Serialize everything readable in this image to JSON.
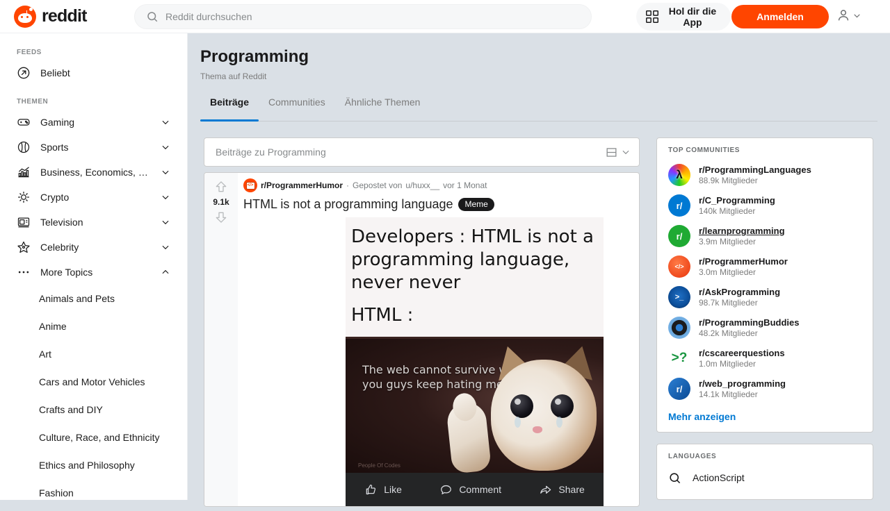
{
  "header": {
    "brand": "reddit",
    "logo_icon": "reddit-logo-icon",
    "search_placeholder": "Reddit durchsuchen",
    "search_icon": "search-icon",
    "get_app_label": "Hol dir die App",
    "qr_icon": "qr-code-icon",
    "login_label": "Anmelden",
    "user_icon": "user-avatar-icon",
    "user_chevron_icon": "chevron-down-icon"
  },
  "sidebar": {
    "feeds_header": "FEEDS",
    "feeds": [
      {
        "label": "Beliebt",
        "icon": "popular-arrow-icon"
      }
    ],
    "topics_header": "THEMEN",
    "topics": [
      {
        "label": "Gaming",
        "icon": "gamepad-icon",
        "chevron": "chevron-down-icon"
      },
      {
        "label": "Sports",
        "icon": "baseball-icon",
        "chevron": "chevron-down-icon"
      },
      {
        "label": "Business, Economics, a...",
        "icon": "bar-chart-icon",
        "chevron": "chevron-down-icon"
      },
      {
        "label": "Crypto",
        "icon": "crypto-icon",
        "chevron": "chevron-down-icon"
      },
      {
        "label": "Television",
        "icon": "television-icon",
        "chevron": "chevron-down-icon"
      },
      {
        "label": "Celebrity",
        "icon": "star-icon",
        "chevron": "chevron-down-icon"
      },
      {
        "label": "More Topics",
        "icon": "ellipsis-icon",
        "chevron": "chevron-up-icon"
      }
    ],
    "more_topics": [
      "Animals and Pets",
      "Anime",
      "Art",
      "Cars and Motor Vehicles",
      "Crafts and DIY",
      "Culture, Race, and Ethnicity",
      "Ethics and Philosophy",
      "Fashion"
    ]
  },
  "main": {
    "title": "Programming",
    "subtitle": "Thema auf Reddit",
    "tabs": [
      {
        "label": "Beiträge",
        "active": true
      },
      {
        "label": "Communities",
        "active": false
      },
      {
        "label": "Ähnliche Themen",
        "active": false
      }
    ],
    "sort": {
      "label": "Beiträge zu Programming",
      "view_icon": "card-view-icon",
      "chevron_icon": "chevron-down-icon"
    },
    "post": {
      "upvote_icon": "upvote-arrow-icon",
      "downvote_icon": "downvote-arrow-icon",
      "score": "9.1k",
      "subreddit": "r/ProgrammerHumor",
      "subreddit_icon": "programmerhumor-avatar-icon",
      "separator": "·",
      "posted_by": "Gepostet von",
      "author": "u/huxx__",
      "age": "vor 1 Monat",
      "title": "HTML is not a programming language",
      "flair": "Meme",
      "image": {
        "top_line_1": "Developers : HTML is not a programming language, never never",
        "top_line_2": "HTML :",
        "caption": "The web cannot survive without me, but you guys keep hating me. Thanks.",
        "watermark": "People Of Codes"
      },
      "actionbar": [
        {
          "label": "Like",
          "icon": "thumbs-up-icon"
        },
        {
          "label": "Comment",
          "icon": "comment-bubble-icon"
        },
        {
          "label": "Share",
          "icon": "share-arrow-icon"
        }
      ]
    }
  },
  "rail": {
    "top_communities": {
      "header": "TOP COMMUNITIES",
      "items": [
        {
          "name": "r/ProgrammingLanguages",
          "members": "88.9k Mitglieder",
          "avatar_color": "#ff4500",
          "avatar_glyph": "λ",
          "underlined": false
        },
        {
          "name": "r/C_Programming",
          "members": "140k Mitglieder",
          "avatar_color": "#0079d3",
          "avatar_glyph": "r/",
          "underlined": false
        },
        {
          "name": "r/learnprogramming",
          "members": "3.9m Mitglieder",
          "avatar_color": "#1faa33",
          "avatar_glyph": "r/",
          "underlined": true
        },
        {
          "name": "r/ProgrammerHumor",
          "members": "3.0m Mitglieder",
          "avatar_color": "#f0501a",
          "avatar_glyph": "</>",
          "underlined": false
        },
        {
          "name": "r/AskProgramming",
          "members": "98.7k Mitglieder",
          "avatar_color": "#0c5fb5",
          "avatar_glyph": ">_",
          "underlined": false
        },
        {
          "name": "r/ProgrammingBuddies",
          "members": "48.2k Mitglieder",
          "avatar_color": "#6aa9e0",
          "avatar_glyph": "◉",
          "underlined": false
        },
        {
          "name": "r/cscareerquestions",
          "members": "1.0m Mitglieder",
          "avatar_color": "#ffffff",
          "avatar_glyph": ">?",
          "underlined": false
        },
        {
          "name": "r/web_programming",
          "members": "14.1k Mitglieder",
          "avatar_color": "#0050a0",
          "avatar_glyph": "r/",
          "underlined": false
        }
      ],
      "show_more": "Mehr anzeigen"
    },
    "languages": {
      "header": "LANGUAGES",
      "items": [
        {
          "name": "ActionScript",
          "icon": "search-icon"
        }
      ]
    }
  }
}
